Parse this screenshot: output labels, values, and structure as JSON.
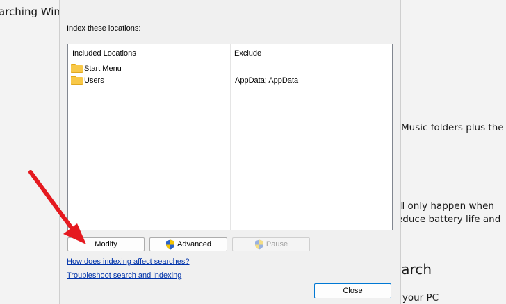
{
  "background": {
    "title_fragment": "arching Windo",
    "right_text_1": "Music folders plus the",
    "right_text_2": "ill only happen when",
    "right_text_3": "educe battery life and",
    "right_heading": "earch",
    "right_text_4": "g your PC"
  },
  "dialog": {
    "label": "Index these locations:",
    "columns": {
      "included": "Included Locations",
      "exclude": "Exclude"
    },
    "locations": [
      {
        "name": "Start Menu",
        "exclude": ""
      },
      {
        "name": "Users",
        "exclude": "AppData; AppData"
      }
    ],
    "buttons": {
      "modify": "Modify",
      "advanced": "Advanced",
      "pause": "Pause",
      "close": "Close"
    },
    "links": {
      "indexing_affect": "How does indexing affect searches?",
      "troubleshoot": "Troubleshoot search and indexing"
    }
  },
  "colors": {
    "arrow": "#e5191f",
    "link": "#0033aa",
    "focus_border": "#0078d4"
  }
}
